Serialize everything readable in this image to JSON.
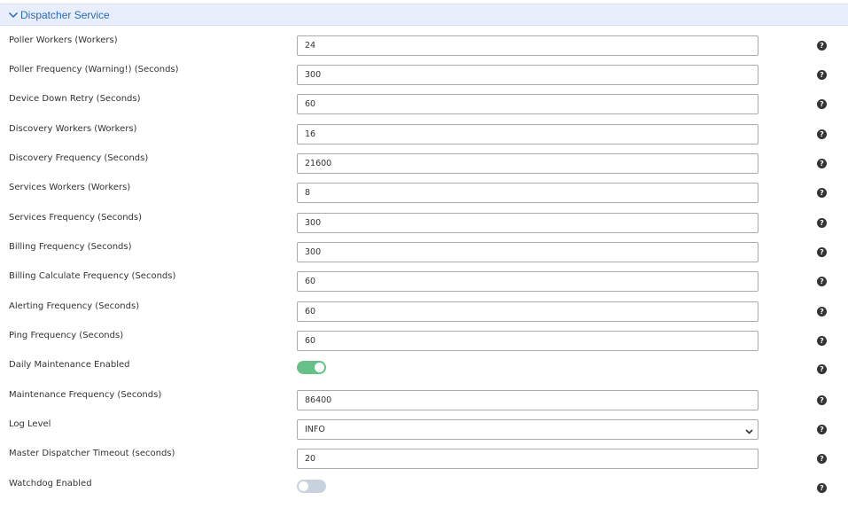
{
  "panel": {
    "title": "Dispatcher Service"
  },
  "help_glyph": "?",
  "rows": [
    {
      "label": "Poller Workers (Workers)",
      "type": "input",
      "value": "24"
    },
    {
      "label": "Poller Frequency (Warning!) (Seconds)",
      "type": "input",
      "value": "300"
    },
    {
      "label": "Device Down Retry (Seconds)",
      "type": "input",
      "value": "60"
    },
    {
      "label": "Discovery Workers (Workers)",
      "type": "input",
      "value": "16"
    },
    {
      "label": "Discovery Frequency (Seconds)",
      "type": "input",
      "value": "21600"
    },
    {
      "label": "Services Workers (Workers)",
      "type": "input",
      "value": "8"
    },
    {
      "label": "Services Frequency (Seconds)",
      "type": "input",
      "value": "300"
    },
    {
      "label": "Billing Frequency (Seconds)",
      "type": "input",
      "value": "300"
    },
    {
      "label": "Billing Calculate Frequency (Seconds)",
      "type": "input",
      "value": "60"
    },
    {
      "label": "Alerting Frequency (Seconds)",
      "type": "input",
      "value": "60"
    },
    {
      "label": "Ping Frequency (Seconds)",
      "type": "input",
      "value": "60"
    },
    {
      "label": "Daily Maintenance Enabled",
      "type": "toggle",
      "enabled": true
    },
    {
      "label": "Maintenance Frequency (Seconds)",
      "type": "input",
      "value": "86400"
    },
    {
      "label": "Log Level",
      "type": "select",
      "value": "INFO"
    },
    {
      "label": "Master Dispatcher Timeout (seconds)",
      "type": "input",
      "value": "20"
    },
    {
      "label": "Watchdog Enabled",
      "type": "toggle",
      "enabled": false
    }
  ]
}
